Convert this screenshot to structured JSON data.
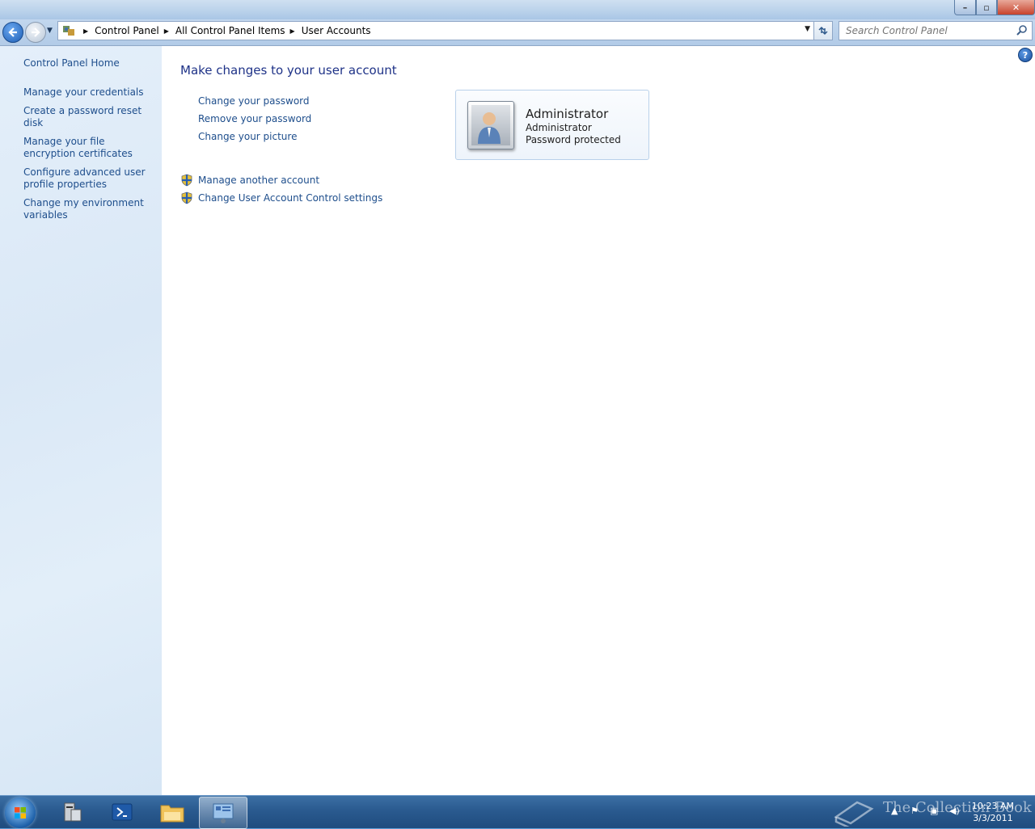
{
  "window": {
    "buttons": {
      "minimize": "–",
      "maximize": "▫",
      "close": "✕"
    }
  },
  "nav": {
    "breadcrumbs": [
      "Control Panel",
      "All Control Panel Items",
      "User Accounts"
    ],
    "search_placeholder": "Search Control Panel"
  },
  "sidebar": {
    "home": "Control Panel Home",
    "links": [
      "Manage your credentials",
      "Create a password reset disk",
      "Manage your file encryption certificates",
      "Configure advanced user profile properties",
      "Change my environment variables"
    ]
  },
  "main": {
    "title": "Make changes to your user account",
    "tasks": [
      "Change your password",
      "Remove your password",
      "Change your picture"
    ],
    "uac_tasks": [
      "Manage another account",
      "Change User Account Control settings"
    ],
    "account": {
      "name": "Administrator",
      "type": "Administrator",
      "status": "Password protected"
    },
    "help": "?"
  },
  "taskbar": {
    "time": "10:23 AM",
    "date": "3/3/2011",
    "watermark": "The Collection Book"
  },
  "colors": {
    "link": "#1e4e8c",
    "title": "#1e3287",
    "taskbar": "#2a5a8f"
  }
}
